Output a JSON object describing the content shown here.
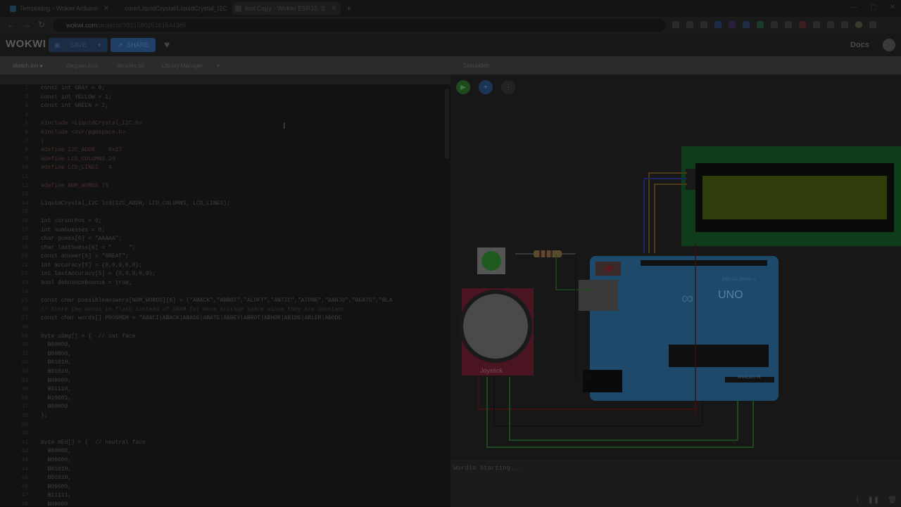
{
  "browser": {
    "tabs": [
      {
        "label": "Templating - Wokwi Arduino",
        "favicon_color": "#1c3a4f"
      },
      {
        "label": "core/LiquidCrystal/LiquidCrystal_I2C",
        "favicon_color": "#2b2b2b"
      },
      {
        "label": "test Copy - Wokwi ESP32, S",
        "favicon_color": "#2b2b2b"
      }
    ],
    "new_tab": "+",
    "url_host": "wokwi.com",
    "url_path": "/projects/382158025161544385"
  },
  "toolbar": {
    "logo": "WOKWI",
    "save_label": "SAVE",
    "share_label": "SHARE",
    "docs_label": "Docs"
  },
  "editor": {
    "tabs": [
      "sketch.ino ●",
      "diagram.json",
      "libraries.txt",
      "Library Manager",
      "▾"
    ],
    "lines": [
      {
        "n": "1",
        "t": "const int GRAY = 0;",
        "k": "code"
      },
      {
        "n": "2",
        "t": "const int YELLOW = 1;",
        "k": "code"
      },
      {
        "n": "3",
        "t": "const int GREEN = 2;",
        "k": "code"
      },
      {
        "n": "4",
        "t": "",
        "k": "code"
      },
      {
        "n": "5",
        "t": "#include <LiquidCrystal_I2C.h>",
        "k": "pp"
      },
      {
        "n": "6",
        "t": "#include <avr/pgmspace.h>",
        "k": "pp"
      },
      {
        "n": "7",
        "t": "|",
        "k": "code"
      },
      {
        "n": "8",
        "t": "#define I2C_ADDR    0x27",
        "k": "pp"
      },
      {
        "n": "9",
        "t": "#define LCD_COLUMNS 20",
        "k": "pp"
      },
      {
        "n": "10",
        "t": "#define LCD_LINES   4",
        "k": "pp"
      },
      {
        "n": "11",
        "t": "",
        "k": "code"
      },
      {
        "n": "12",
        "t": "#define NUM_WORDS 75",
        "k": "pp"
      },
      {
        "n": "13",
        "t": "",
        "k": "code"
      },
      {
        "n": "14",
        "t": "LiquidCrystal_I2C lcd(I2C_ADDR, LCD_COLUMNS, LCD_LINES);",
        "k": "code"
      },
      {
        "n": "15",
        "t": "",
        "k": "code"
      },
      {
        "n": "16",
        "t": "int cursorPos = 0;",
        "k": "code"
      },
      {
        "n": "17",
        "t": "int numGuesses = 0;",
        "k": "code"
      },
      {
        "n": "18",
        "t": "char guess[6] = \"AAAAA\";",
        "k": "code"
      },
      {
        "n": "19",
        "t": "char lastGuess[6] = \"     \";",
        "k": "code"
      },
      {
        "n": "20",
        "t": "const answer[6] = \"GREAT\";",
        "k": "code"
      },
      {
        "n": "21",
        "t": "int accuracy[5] = {0,0,0,0,0};",
        "k": "code"
      },
      {
        "n": "22",
        "t": "int lastAccuracy[5] = {0,0,0,0,0};",
        "k": "code"
      },
      {
        "n": "23",
        "t": "bool debounceBounce = true;",
        "k": "code"
      },
      {
        "n": "24",
        "t": "",
        "k": "code"
      },
      {
        "n": "25",
        "t": "const char possibleAnswers[NUM_WORDS][6] = {\"ABACK\",\"ABBOT\",\"ALOFT\",\"ANTIC\",\"ATONE\",\"BANJO\",\"BEATS\",\"BLA",
        "k": "code"
      },
      {
        "n": "26",
        "t": "// Store the words in flash instead of SRAM for more storage space since they are constant",
        "k": "cmt"
      },
      {
        "n": "27",
        "t": "const char words[] PROGMEM = \"ABACI|ABACK|ABASE|ABATE|ABBEY|ABBOT|ABHOR|ABIDE|ABLER|ABODE",
        "k": "code"
      },
      {
        "n": "28",
        "t": "",
        "k": "code"
      },
      {
        "n": "29",
        "t": "byte uSmg[] = {  // cat face",
        "k": "code"
      },
      {
        "n": "30",
        "t": "  B00000,",
        "k": "code"
      },
      {
        "n": "31",
        "t": "  B00000,",
        "k": "code"
      },
      {
        "n": "32",
        "t": "  B01010,",
        "k": "code"
      },
      {
        "n": "33",
        "t": "  B01010,",
        "k": "code"
      },
      {
        "n": "34",
        "t": "  B00000,",
        "k": "code"
      },
      {
        "n": "35",
        "t": "  B01110,",
        "k": "code"
      },
      {
        "n": "36",
        "t": "  B10001,",
        "k": "code"
      },
      {
        "n": "37",
        "t": "  B00000",
        "k": "code"
      },
      {
        "n": "38",
        "t": "};",
        "k": "code"
      },
      {
        "n": "39",
        "t": "",
        "k": "code"
      },
      {
        "n": "40",
        "t": "",
        "k": "code"
      },
      {
        "n": "41",
        "t": "byte mEd[] = {  // neutral face",
        "k": "code"
      },
      {
        "n": "42",
        "t": "  B00000,",
        "k": "code"
      },
      {
        "n": "43",
        "t": "  B00000,",
        "k": "code"
      },
      {
        "n": "44",
        "t": "  B01010,",
        "k": "code"
      },
      {
        "n": "45",
        "t": "  B01010,",
        "k": "code"
      },
      {
        "n": "46",
        "t": "  B00000,",
        "k": "code"
      },
      {
        "n": "47",
        "t": "  B11111,",
        "k": "code"
      },
      {
        "n": "48",
        "t": "  B00000",
        "k": "code"
      }
    ]
  },
  "simulation": {
    "tab_label": "Simulation",
    "play_icon": "play-icon",
    "add_icon": "plus-icon",
    "more_icon": "more-icon",
    "arduino_label": "UNO",
    "arduino_digital": "DIGITAL (PWM ~)",
    "arduino_analog": "ANALOG IN",
    "joystick_label": "Joystick",
    "serial_output": "Wordle Starting..."
  },
  "colors": {
    "accent_blue": "#1f3f66",
    "arduino_blue": "#1d4a6b",
    "lcd_green": "#2f3d0a",
    "lcd_pcb": "#0f3d1c",
    "button_green": "#1f5b1f"
  }
}
